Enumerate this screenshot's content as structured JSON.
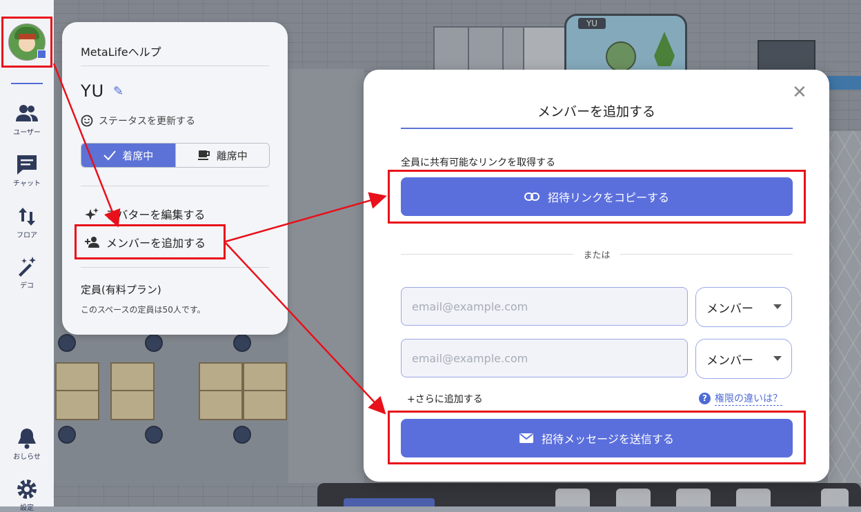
{
  "sidebar": {
    "items": [
      {
        "label": "ユーザー",
        "icon": "users-icon"
      },
      {
        "label": "チャット",
        "icon": "chat-icon"
      },
      {
        "label": "フロア",
        "icon": "floor-icon"
      },
      {
        "label": "デコ",
        "icon": "magic-wand-icon"
      },
      {
        "label": "おしらせ",
        "icon": "bell-icon"
      },
      {
        "label": "設定",
        "icon": "gear-icon"
      }
    ]
  },
  "scene": {
    "name_tag": "YU"
  },
  "help_panel": {
    "title": "MetaLifeヘルプ",
    "username": "YU",
    "status_update": "ステータスを更新する",
    "status_present": "着席中",
    "status_away": "離席中",
    "edit_avatar": "アバターを編集する",
    "add_member": "メンバーを追加する",
    "plan_title": "定員(有料プラン)",
    "plan_desc": "このスペースの定員は50人です。"
  },
  "modal": {
    "title": "メンバーを追加する",
    "share_label": "全員に共有可能なリンクを取得する",
    "copy_link_button": "招待リンクをコピーする",
    "or_text": "または",
    "email_rows": [
      {
        "placeholder": "email@example.com",
        "role": "メンバー"
      },
      {
        "placeholder": "email@example.com",
        "role": "メンバー"
      }
    ],
    "add_more": "+さらに追加する",
    "permission_link": "権限の違いは？",
    "send_button": "招待メッセージを送信する"
  },
  "colors": {
    "accent": "#5b6fdc",
    "annotation_red": "#e8101a"
  }
}
